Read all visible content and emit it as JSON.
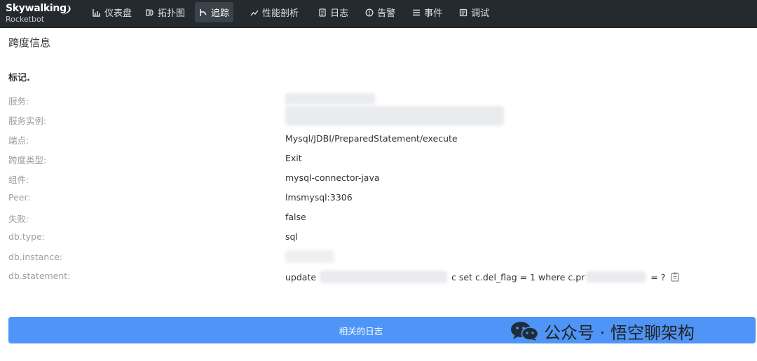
{
  "brand": {
    "name": "Skywalking",
    "sub": "Rocketbot"
  },
  "nav": {
    "items": [
      {
        "label": "仪表盘",
        "icon": "chart-icon"
      },
      {
        "label": "拓扑图",
        "icon": "topology-icon"
      },
      {
        "label": "追踪",
        "icon": "trace-icon",
        "active": true
      },
      {
        "label": "性能剖析",
        "icon": "trend-icon"
      },
      {
        "label": "日志",
        "icon": "log-icon"
      },
      {
        "label": "告警",
        "icon": "alert-icon"
      },
      {
        "label": "事件",
        "icon": "list-icon"
      },
      {
        "label": "调试",
        "icon": "debug-icon"
      }
    ]
  },
  "page": {
    "title": "跨度信息",
    "section_title": "标记."
  },
  "tags": [
    {
      "key": "服务:",
      "value": ""
    },
    {
      "key": "服务实例:",
      "value": ""
    },
    {
      "key": "端点:",
      "value": "Mysql/JDBI/PreparedStatement/execute"
    },
    {
      "key": "跨度类型:",
      "value": "Exit"
    },
    {
      "key": "组件:",
      "value": "mysql-connector-java"
    },
    {
      "key": "Peer:",
      "value": "lmsmysql:3306"
    },
    {
      "key": "失败:",
      "value": "false"
    },
    {
      "key": "db.type:",
      "value": "sql"
    },
    {
      "key": "db.instance:",
      "value": ""
    },
    {
      "key": "db.statement:",
      "value": ""
    }
  ],
  "statement": {
    "part1": "update",
    "part2": "c set c.del_flag = 1 where c.pr",
    "part3": "= ?"
  },
  "buttons": {
    "related_logs": "相关的日志"
  },
  "watermark": {
    "text": "公众号 · 悟空聊架构"
  },
  "colors": {
    "topbar": "#252a2f",
    "active_nav": "#3b4249",
    "button": "#4f95f8",
    "label": "#9aa0a6"
  }
}
